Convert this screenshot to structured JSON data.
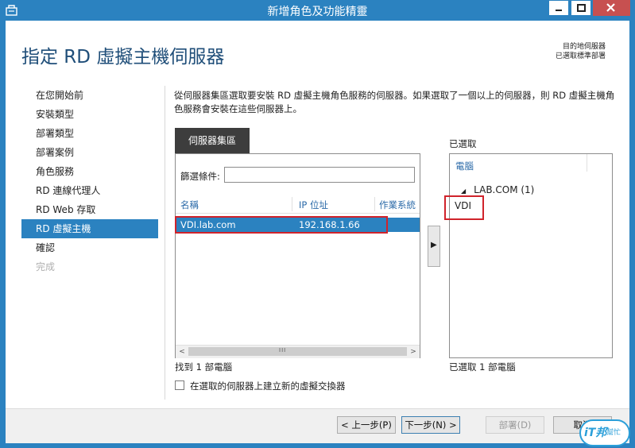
{
  "window": {
    "title": "新增角色及功能精靈"
  },
  "page": {
    "title": "指定 RD 虛擬主機伺服器",
    "dest_line1": "目的地伺服器",
    "dest_line2": "已選取標準部署"
  },
  "nav": {
    "items": [
      {
        "label": "在您開始前",
        "state": "normal"
      },
      {
        "label": "安裝類型",
        "state": "normal"
      },
      {
        "label": "部署類型",
        "state": "normal"
      },
      {
        "label": "部署案例",
        "state": "normal"
      },
      {
        "label": "角色服務",
        "state": "normal"
      },
      {
        "label": "RD 連線代理人",
        "state": "normal"
      },
      {
        "label": "RD Web 存取",
        "state": "normal"
      },
      {
        "label": "RD 虛擬主機",
        "state": "active"
      },
      {
        "label": "確認",
        "state": "normal"
      },
      {
        "label": "完成",
        "state": "disabled"
      }
    ]
  },
  "content": {
    "description": "從伺服器集區選取要安裝 RD 虛擬主機角色服務的伺服器。如果選取了一個以上的伺服器，則 RD 虛擬主機角色服務會安裝在這些伺服器上。",
    "tab_label": "伺服器集區",
    "filter_label": "篩選條件:",
    "filter_value": "",
    "columns": {
      "name": "名稱",
      "ip": "IP 位址",
      "os": "作業系統"
    },
    "rows": [
      {
        "name": "VDI.lab.com",
        "ip": "192.168.1.66"
      }
    ],
    "found_text": "找到 1 部電腦",
    "add_arrow": "▶",
    "selected_label": "已選取",
    "selected_header": "電腦",
    "selected_domain": "LAB.COM (1)",
    "selected_item": "VDI",
    "selected_count": "已選取 1 部電腦",
    "checkbox_label": "在選取的伺服器上建立新的虛擬交換器"
  },
  "footer": {
    "prev": "< 上一步(P)",
    "next": "下一步(N) >",
    "deploy": "部署(D)",
    "cancel": "取消"
  },
  "watermark": {
    "text": "iT邦",
    "sub": "幫忙"
  },
  "colors": {
    "accent": "#2b82c0",
    "highlight": "#d0232b"
  }
}
